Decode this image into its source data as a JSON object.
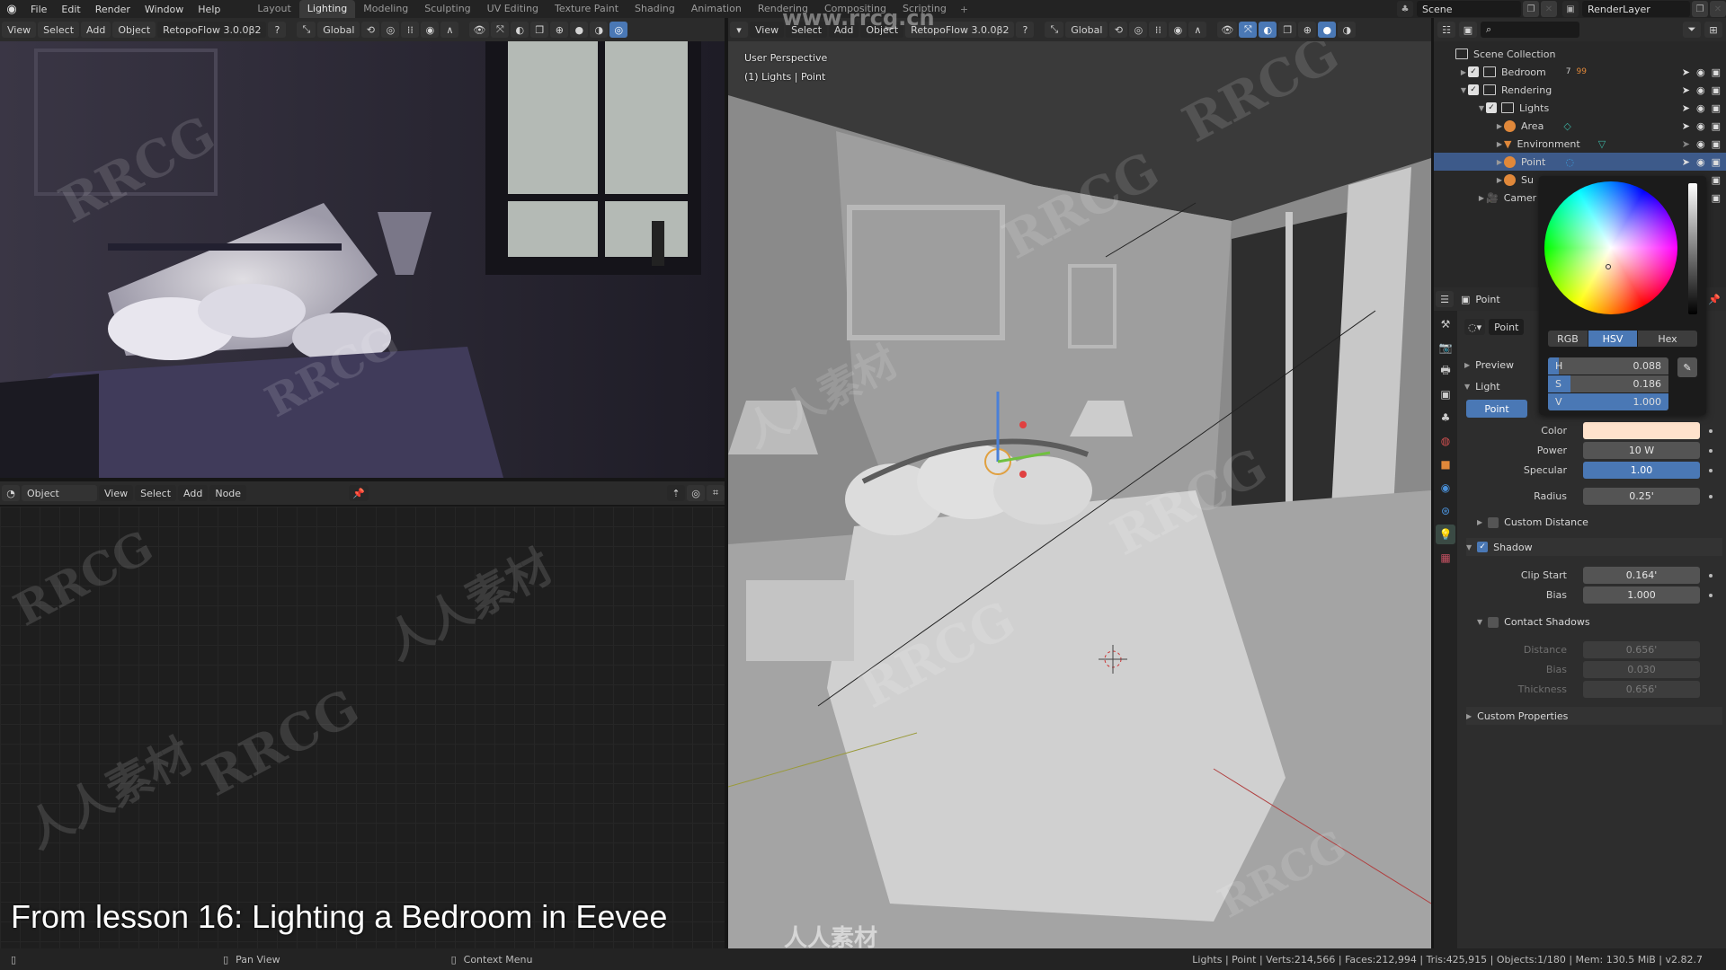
{
  "topbar": {
    "menus": [
      "File",
      "Edit",
      "Render",
      "Window",
      "Help"
    ],
    "workspaces": [
      "Layout",
      "Lighting",
      "Modeling",
      "Sculpting",
      "UV Editing",
      "Texture Paint",
      "Shading",
      "Animation",
      "Rendering",
      "Compositing",
      "Scripting"
    ],
    "active_workspace": "Lighting",
    "add_workspace": "+",
    "scene": "Scene",
    "render_layer": "RenderLayer"
  },
  "left_viewport_header": {
    "view": "View",
    "select": "Select",
    "add": "Add",
    "object": "Object",
    "addon": "RetopoFlow 3.0.0β2",
    "orientation": "Global"
  },
  "main_viewport_header": {
    "view": "View",
    "select": "Select",
    "add": "Add",
    "object": "Object",
    "addon": "RetopoFlow 3.0.0β2",
    "orientation": "Global"
  },
  "main_viewport": {
    "perspective_label": "User Perspective",
    "context_label": "(1) Lights | Point"
  },
  "node_editor_header": {
    "mode": "Object",
    "view": "View",
    "select": "Select",
    "add": "Add",
    "node": "Node"
  },
  "caption": "From lesson 16: Lighting a Bedroom in Eevee",
  "outliner": {
    "search_placeholder": "",
    "root": "Scene Collection",
    "rows": [
      {
        "name": "Bedroom",
        "type": "collection",
        "badge_children": "7",
        "badge_mesh": "99"
      },
      {
        "name": "Rendering",
        "type": "collection"
      },
      {
        "name": "Lights",
        "type": "collection"
      },
      {
        "name": "Area",
        "type": "light"
      },
      {
        "name": "Environment",
        "type": "light-probe"
      },
      {
        "name": "Point",
        "type": "light",
        "selected": true
      },
      {
        "name": "Su",
        "type": "light"
      },
      {
        "name": "Camer",
        "type": "camera"
      }
    ]
  },
  "properties": {
    "object_name": "Point",
    "data_name": "Point",
    "panels": {
      "preview": "Preview",
      "light": "Light",
      "custom_distance": "Custom Distance",
      "shadow": "Shadow",
      "contact_shadows": "Contact Shadows",
      "custom_properties": "Custom Properties"
    },
    "light_type": "Point",
    "fields": {
      "color_label": "Color",
      "color_value": "#ffe3cc",
      "power_label": "Power",
      "power": "10 W",
      "specular_label": "Specular",
      "specular": "1.00",
      "radius_label": "Radius",
      "radius": "0.25'",
      "clip_start_label": "Clip Start",
      "clip_start": "0.164'",
      "bias_label": "Bias",
      "bias": "1.000",
      "cs_distance_label": "Distance",
      "cs_distance": "0.656'",
      "cs_bias_label": "Bias",
      "cs_bias": "0.030",
      "cs_thickness_label": "Thickness",
      "cs_thickness": "0.656'"
    },
    "custom_distance_enabled": false,
    "shadow_enabled": true,
    "contact_shadows_enabled": false
  },
  "color_picker": {
    "modes": [
      "RGB",
      "HSV",
      "Hex"
    ],
    "active_mode": "HSV",
    "h_label": "H",
    "h": "0.088",
    "h_frac": 0.088,
    "s_label": "S",
    "s": "0.186",
    "s_frac": 0.186,
    "v_label": "V",
    "v": "1.000",
    "v_frac": 1.0
  },
  "statusbar": {
    "pan_view": "Pan View",
    "context_menu": "Context Menu",
    "stats": "Lights | Point | Verts:214,566 | Faces:212,994 | Tris:425,915 | Objects:1/180 | Mem: 130.5 MiB | v2.82.7"
  },
  "watermarks": {
    "site": "www.rrcg.cn",
    "brand": "RRCG",
    "footer_brand": "人人素材"
  }
}
